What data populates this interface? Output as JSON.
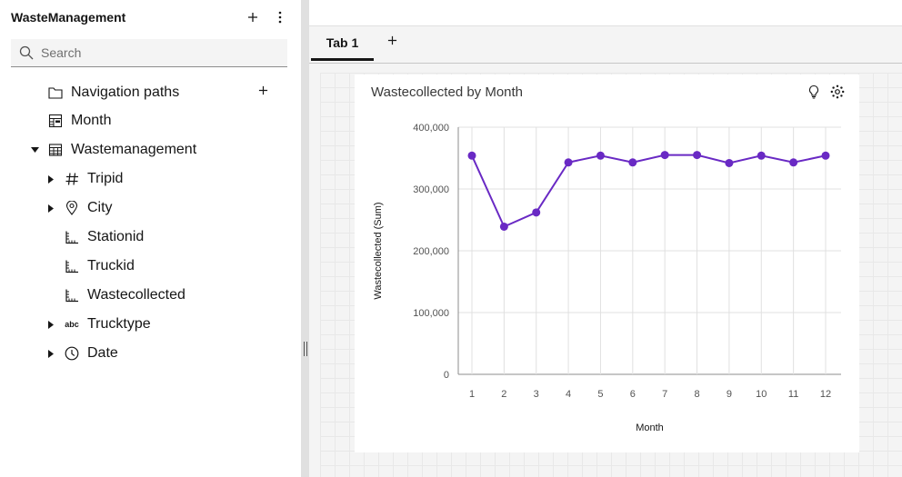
{
  "app": {
    "title": "WasteManagement"
  },
  "search": {
    "placeholder": "Search"
  },
  "tree": {
    "items": [
      {
        "label": "Navigation paths",
        "icon": "folder-icon"
      },
      {
        "label": "Month",
        "icon": "table-icon"
      },
      {
        "label": "Wastemanagement",
        "icon": "table-icon"
      },
      {
        "label": "Tripid",
        "icon": "hash-icon"
      },
      {
        "label": "City",
        "icon": "location-icon"
      },
      {
        "label": "Stationid",
        "icon": "measure-icon"
      },
      {
        "label": "Truckid",
        "icon": "measure-icon"
      },
      {
        "label": "Wastecollected",
        "icon": "measure-icon"
      },
      {
        "label": "Trucktype",
        "icon": "text-type-icon"
      },
      {
        "label": "Date",
        "icon": "clock-icon"
      }
    ],
    "text_type_glyph": "abc"
  },
  "tabs": [
    {
      "label": "Tab 1"
    }
  ],
  "chart_data": {
    "type": "line",
    "title": "Wastecollected by Month",
    "xlabel": "Month",
    "ylabel": "Wastecollected (Sum)",
    "categories": [
      "1",
      "2",
      "3",
      "4",
      "5",
      "6",
      "7",
      "8",
      "9",
      "10",
      "11",
      "12"
    ],
    "values": [
      354000,
      239000,
      262000,
      343000,
      354000,
      343000,
      355000,
      355000,
      342000,
      354000,
      343000,
      354000
    ],
    "ylim": [
      0,
      400000
    ],
    "yticks": [
      "0",
      "100,000",
      "200,000",
      "300,000",
      "400,000"
    ],
    "grid": true,
    "color": "#6929c4"
  },
  "colors": {
    "accent": "#6929c4",
    "text": "#161616"
  }
}
